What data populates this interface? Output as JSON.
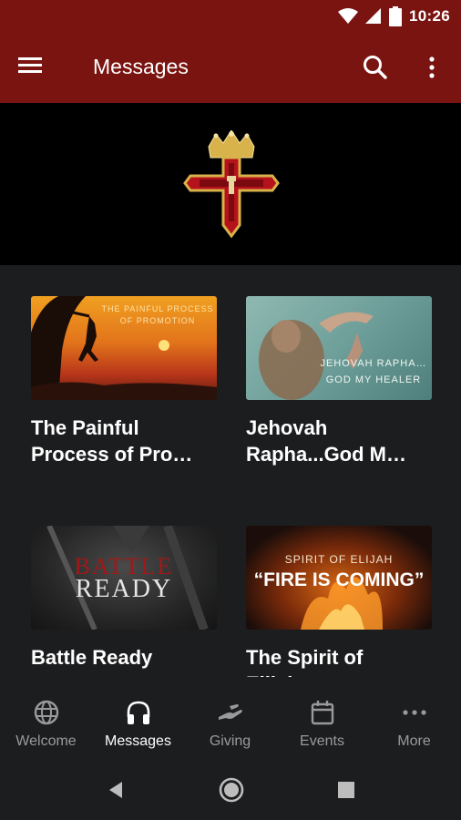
{
  "status_bar": {
    "time": "10:26"
  },
  "app_bar": {
    "title": "Messages"
  },
  "messages": [
    {
      "title": "The Painful\nProcess of Pro…",
      "thumb_line1": "THE PAINFUL PROCESS",
      "thumb_line2": "OF PROMOTION"
    },
    {
      "title": "Jehovah\nRapha...God M…",
      "thumb_line1": "JEHOVAH RAPHA…",
      "thumb_line2": "GOD MY HEALER"
    },
    {
      "title": "Battle Ready",
      "thumb_line1": "BATTLE",
      "thumb_line2": "READY"
    },
    {
      "title": "The Spirit of\nElijah",
      "thumb_line1": "SPIRIT OF ELIJAH",
      "thumb_line2": "“FIRE IS COMING”"
    }
  ],
  "bottom_nav": [
    {
      "label": "Welcome",
      "icon": "globe-icon",
      "active": false
    },
    {
      "label": "Messages",
      "icon": "headphones-icon",
      "active": true
    },
    {
      "label": "Giving",
      "icon": "giving-hand-icon",
      "active": false
    },
    {
      "label": "Events",
      "icon": "calendar-icon",
      "active": false
    },
    {
      "label": "More",
      "icon": "more-horiz-icon",
      "active": false
    }
  ],
  "colors": {
    "app_bar": "#7a1410",
    "background": "#1c1d1f",
    "inactive": "#9a9a9a",
    "active": "#ffffff"
  }
}
